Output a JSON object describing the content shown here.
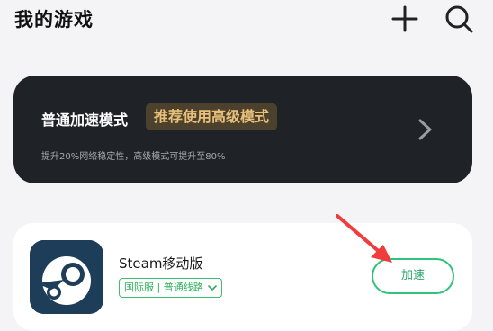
{
  "header": {
    "title": "我的游戏",
    "add_icon": "plus-icon",
    "search_icon": "search-icon"
  },
  "mode_card": {
    "title": "普通加速模式",
    "tag": "推荐使用高级模式",
    "description": "提升20%网络稳定性，高级模式可提升至80%",
    "arrow_icon": "chevron-right-icon"
  },
  "game": {
    "name": "Steam移动版",
    "server": "国际服 | 普通线路",
    "accelerate_label": "加速",
    "icon": "steam-logo-icon"
  },
  "colors": {
    "background": "#f4f4f6",
    "card_dark": "#1f2327",
    "tag_text": "#e9c07a",
    "accent_green": "#2ec27a",
    "pointer_red": "#f03c3c"
  }
}
